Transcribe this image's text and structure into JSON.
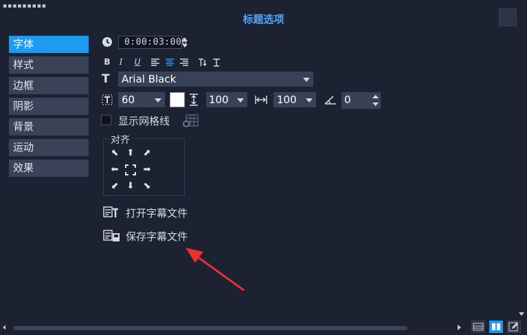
{
  "window": {
    "title": "标题选项"
  },
  "sidebar": {
    "items": [
      {
        "label": "字体",
        "active": true
      },
      {
        "label": "样式"
      },
      {
        "label": "边框"
      },
      {
        "label": "阴影"
      },
      {
        "label": "背景"
      },
      {
        "label": "运动"
      },
      {
        "label": "效果"
      }
    ]
  },
  "font": {
    "duration": "0:00:03:000",
    "style_buttons": [
      "B",
      "I",
      "U"
    ],
    "family": "Arial Black",
    "size": "60",
    "color": "#ffffff",
    "line_spacing": "100",
    "tracking": "100",
    "angle": "0",
    "show_grid_label": "显示网格线"
  },
  "align": {
    "label": "对齐"
  },
  "actions": {
    "open_subtitle": "打开字幕文件",
    "save_subtitle": "保存字幕文件"
  },
  "colors": {
    "accent": "#1c9bf0",
    "title": "#4ea6ff",
    "background": "#1d2232",
    "annotation": "#e8312f"
  }
}
